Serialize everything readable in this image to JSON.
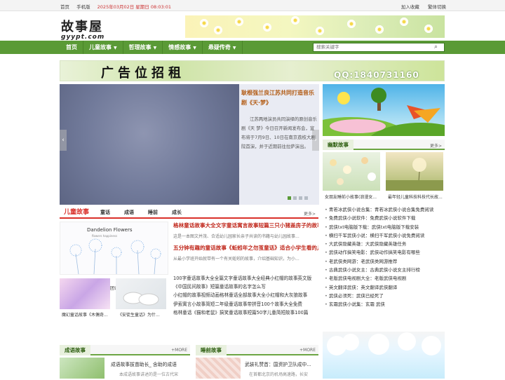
{
  "topbar": {
    "home": "首页",
    "mobile": "手机版",
    "date": "2025年03月02日 星期日 08:03:01",
    "favorite": "加入收藏",
    "traditional": "繁体切换"
  },
  "logo": {
    "cn": "故事屋",
    "en": "gyypt.com"
  },
  "nav": {
    "items": [
      "首页",
      "儿童故事",
      "哲理故事",
      "情感故事",
      "悬疑传奇"
    ],
    "search_placeholder": "搜索关键字"
  },
  "ad": {
    "text": "广告位招租",
    "qq": "QQ:1840731160"
  },
  "slider": {
    "title": "耿根强兰良江苏共同打造音乐剧《天·梦》",
    "desc": "江苏两地演员共同演绎的原创音乐剧《天 梦》今日召开新闻发布会，宣布将于7月9日、10日在南京荔枝大剧院首演，并于近期前往拉萨演出。"
  },
  "humor": {
    "tag": "幽默故事",
    "more": "更多>",
    "captions": [
      "女朋友睡前小故事(浪漫女...",
      "最年轻儿童科技科技代长故..."
    ]
  },
  "right_links": [
    "青若冰武侠小说合集：青若冰武侠小说合集免费阅读",
    "免费武侠小说软件：免费武侠小说软件下载",
    "武侠txt电脑版下载：武侠txt电脑版下载安装",
    "横扫千军武侠小说：横扫千军武侠小说免费阅读",
    "大武侠隐藏英雄：大武侠隐藏英雄任务",
    "武侠动作搞笑电影：武侠动作搞笑电影有哪些",
    "老武侠类网游：老武侠类网游推荐",
    "古典武侠小说女主：古典武侠小说女主排行榜",
    "老版武侠电视剧大全：老版武侠电视剧",
    "英文翻译武侠：英文翻译武侠翻译",
    "武侠必须死：武侠已经死了",
    "玄霜武侠小说集：玄霜 武侠"
  ],
  "kids": {
    "tag": "儿童故事",
    "tabs": [
      "童话",
      "成语",
      "睡前",
      "成长"
    ],
    "more": "更多>",
    "img_title": "Dandelion Flowers",
    "img_sub": "flowers happiness",
    "caption": "【文小青怀深家长】肥皂布团合小学2021级6班采梦旗...",
    "h1": "格林童话故事大全文字童话寓言故事短篇三只小猪盖房子的故事",
    "d1": "这是一本图文并茂、合适幼儿园家长亲子共读的书籍与幼儿园故事...",
    "h2": "五分钟有趣的童话故事《蚯蚓年之勿茧童话》适合小学生看的儿童故事",
    "d2": "从最小学班开始就带有一个有关蚯蚓的故事，介绍基础知识，为小...",
    "list": [
      "100字童话故事大全全篇文字童话故事大全经典小红帽的故事英文版",
      "《中国民间故事》短篇童话故事的名字怎么写",
      "小红帽的故事视频动画格林童话全部故事大全小红帽和大灰狼故事",
      "伊索寓言小故事简短二年级童话故事带拼音100个故事大全免费",
      "格林童话《猫和老鼠》搞笑童话故事短篇50字儿童简短故事100篇"
    ],
    "small_caps": [
      "魔幻童话故事《木偶奇...",
      "《安徒生童话》为什..."
    ]
  },
  "idiom": {
    "tag": "成语故事",
    "more": "+MORE",
    "title": "成语故事拔苗助长_ 含助的成语",
    "desc": "本成语故事讲述的是一位古代宋"
  },
  "bedtime": {
    "tag": "睡前故事",
    "more": "+MORE",
    "title": "武装礼赞首：国资护卫队成中...",
    "desc": "在首都北京的机场高速路，长安"
  }
}
